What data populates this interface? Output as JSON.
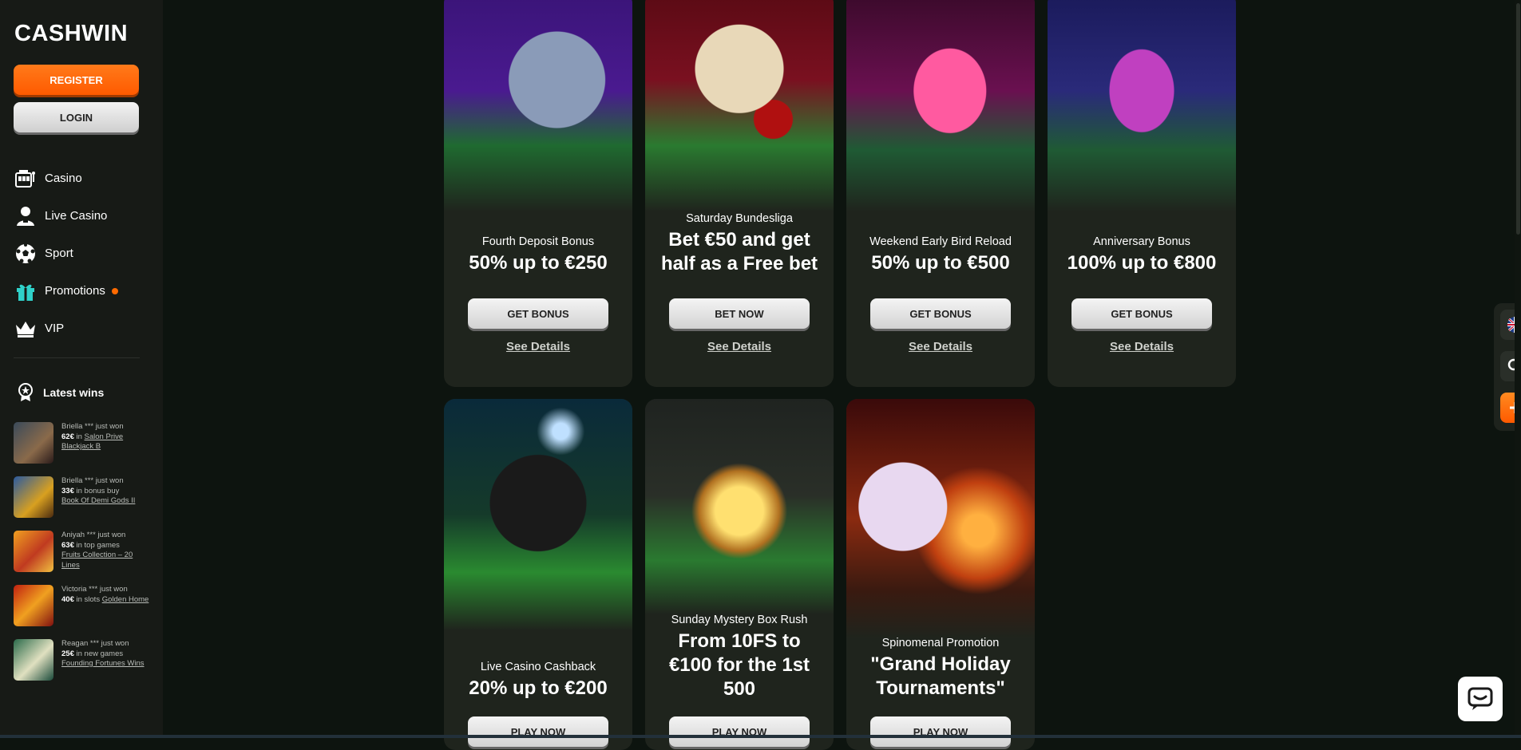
{
  "brand": {
    "logo_text": "CASHWIN",
    "accent": "#ff6a00"
  },
  "auth": {
    "register_label": "REGISTER",
    "login_label": "LOGIN"
  },
  "nav": [
    {
      "label": "Casino",
      "icon": "slot-machine-icon"
    },
    {
      "label": "Live Casino",
      "icon": "dealer-icon"
    },
    {
      "label": "Sport",
      "icon": "soccer-ball-icon"
    },
    {
      "label": "Promotions",
      "icon": "gift-icon"
    },
    {
      "label": "VIP",
      "icon": "crown-icon"
    }
  ],
  "latest_wins": {
    "title": "Latest wins",
    "items": [
      {
        "player": "Briella *** just won",
        "amount": "62€",
        "context": "in",
        "game": "Salon Prive Blackjack B"
      },
      {
        "player": "Briella *** just won",
        "amount": "33€",
        "context": "in bonus buy",
        "game": "Book Of Demi Gods II"
      },
      {
        "player": "Aniyah *** just won",
        "amount": "63€",
        "context": "in top games",
        "game": "Fruits Collection – 20 Lines"
      },
      {
        "player": "Victoria *** just won",
        "amount": "40€",
        "context": "in slots",
        "game": "Golden Home"
      },
      {
        "player": "Reagan *** just won",
        "amount": "25€",
        "context": "in new games",
        "game": "Founding Fortunes Wins"
      }
    ]
  },
  "promotions": [
    {
      "subtitle": "Fourth Deposit Bonus",
      "title": "50% up to €250",
      "button": "GET BONUS",
      "link": "See Details"
    },
    {
      "subtitle": "Saturday Bundesliga",
      "title": "Bet €50 and get half as a Free bet",
      "button": "BET NOW",
      "link": "See Details"
    },
    {
      "subtitle": "Weekend Early Bird Reload",
      "title": "50% up to €500",
      "button": "GET BONUS",
      "link": "See Details"
    },
    {
      "subtitle": "Anniversary Bonus",
      "title": "100% up to €800",
      "button": "GET BONUS",
      "link": "See Details"
    },
    {
      "subtitle": "Live Casino Cashback",
      "title": "20% up to €200",
      "button": "PLAY NOW"
    },
    {
      "subtitle": "Sunday Mystery Box Rush",
      "title": "From 10FS to €100 for the 1st 500",
      "button": "PLAY NOW"
    },
    {
      "subtitle": "Spinomenal Promotion",
      "title": "\"Grand Holiday Tournaments\"",
      "button": "PLAY NOW"
    }
  ],
  "widgets": [
    "uk-flag-icon",
    "search-icon",
    "plus-icon"
  ],
  "chat": "chat-icon"
}
